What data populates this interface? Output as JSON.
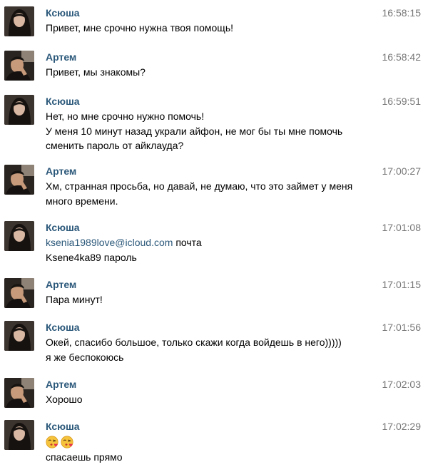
{
  "messages": [
    {
      "sender": "Ксюша",
      "time": "16:58:15",
      "avatar": "ksyusha-avatar",
      "lines": [
        "Привет, мне срочно нужна твоя помощь!"
      ]
    },
    {
      "sender": "Артем",
      "time": "16:58:42",
      "avatar": "artem-avatar",
      "lines": [
        "Привет, мы знакомы?"
      ]
    },
    {
      "sender": "Ксюша",
      "time": "16:59:51",
      "avatar": "ksyusha-avatar",
      "lines": [
        "Нет, но мне срочно нужно помочь!",
        "У меня 10 минут назад украли айфон, не мог бы ты мне помочь",
        "сменить пароль от айклауда?"
      ]
    },
    {
      "sender": "Артем",
      "time": "17:00:27",
      "avatar": "artem-avatar",
      "lines": [
        "Хм, странная просьба, но давай, не думаю, что это займет у меня",
        "много времени."
      ]
    },
    {
      "sender": "Ксюша",
      "time": "17:01:08",
      "avatar": "ksyusha-avatar",
      "email_link": "ksenia1989love@icloud.com",
      "email_suffix": " почта",
      "lines": [
        "Ksene4ka89 пароль"
      ]
    },
    {
      "sender": "Артем",
      "time": "17:01:15",
      "avatar": "artem-avatar",
      "lines": [
        "Пара минут!"
      ]
    },
    {
      "sender": "Ксюша",
      "time": "17:01:56",
      "avatar": "ksyusha-avatar",
      "lines": [
        "Окей, спасибо большое, только скажи когда войдешь в него)))))",
        "я же беспокоюсь"
      ]
    },
    {
      "sender": "Артем",
      "time": "17:02:03",
      "avatar": "artem-avatar",
      "lines": [
        "Хорошо"
      ]
    },
    {
      "sender": "Ксюша",
      "time": "17:02:29",
      "avatar": "ksyusha-avatar",
      "emoji": [
        "kissing-heart-emoji",
        "kissing-heart-emoji"
      ],
      "lines": [
        "спасаешь прямо"
      ]
    }
  ],
  "colors": {
    "sender_name": "#2b587a",
    "timestamp": "#777777",
    "link": "#2b587a",
    "text": "#000000",
    "background": "#ffffff"
  }
}
